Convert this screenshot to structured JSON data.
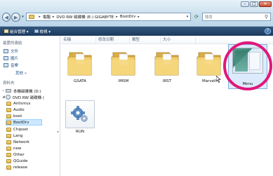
{
  "window": {
    "controls": {
      "minimize": "–",
      "maximize": "□",
      "close": "✕"
    }
  },
  "nav": {
    "back_glyph": "◀",
    "forward_glyph": "▶",
    "breadcrumb": [
      "電腦",
      "DVD RW 磁碟機 (E:) GIGABYTE",
      "BootDrv"
    ],
    "search_placeholder": "搜尋"
  },
  "toolbar": {
    "organize": "組合管理 ▾",
    "views": "檢視 ▾"
  },
  "sidebar": {
    "favorites_heading": "最愛的連結",
    "favorites": [
      "文件",
      "圖片",
      "音樂"
    ],
    "more": "其他 »",
    "folders_heading": "資料夾",
    "tree": [
      {
        "label": "本機磁碟機 (D:)",
        "kind": "drive",
        "level": 1
      },
      {
        "label": "DVD RW 磁碟機 (",
        "kind": "dvd",
        "level": 1
      },
      {
        "label": "Antivirus",
        "kind": "folder",
        "level": 2
      },
      {
        "label": "Audio",
        "kind": "folder",
        "level": 2
      },
      {
        "label": "boot",
        "kind": "folder",
        "level": 2
      },
      {
        "label": "BootDrv",
        "kind": "folder",
        "level": 2,
        "selected": true
      },
      {
        "label": "Chipset",
        "kind": "folder",
        "level": 2
      },
      {
        "label": "Lang",
        "kind": "folder",
        "level": 2
      },
      {
        "label": "Network",
        "kind": "folder",
        "level": 2
      },
      {
        "label": "new",
        "kind": "folder",
        "level": 2
      },
      {
        "label": "Other",
        "kind": "folder",
        "level": 2
      },
      {
        "label": "QGuide",
        "kind": "folder",
        "level": 2
      },
      {
        "label": "release",
        "kind": "folder",
        "level": 2
      }
    ]
  },
  "columns": [
    "名稱",
    "修改日期",
    "類型",
    "大小"
  ],
  "files": [
    {
      "name": "GSATA",
      "type": "folder"
    },
    {
      "name": "IMSM",
      "type": "folder"
    },
    {
      "name": "IRST",
      "type": "folder"
    },
    {
      "name": "Marvell",
      "type": "folder"
    },
    {
      "name": "Menu",
      "type": "image",
      "selected": true
    },
    {
      "name": "RUN",
      "type": "application"
    }
  ],
  "colors": {
    "toolbar_bg": "#1c3a5e",
    "selection_bg": "#dcebfc",
    "highlight_ring": "#e0187a"
  }
}
